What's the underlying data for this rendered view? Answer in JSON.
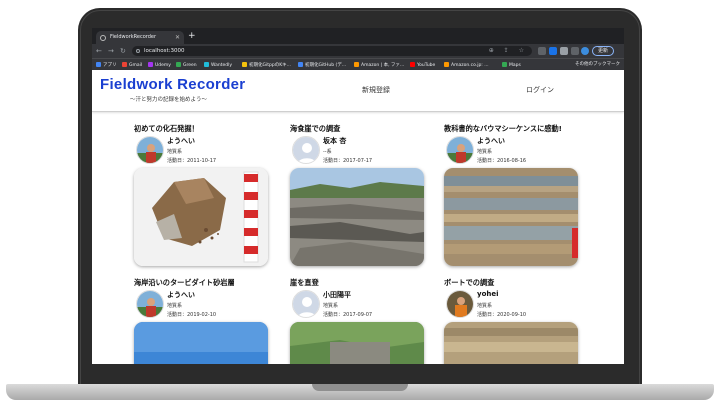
{
  "browser": {
    "tab_title": "FieldworkRecorder",
    "new_tab": "+",
    "url": "localhost:3000",
    "update_label": "更新",
    "bookmarks": [
      {
        "label": "アプリ",
        "icon": "apps-icon",
        "color": "#4285f4"
      },
      {
        "label": "Gmail",
        "icon": "gmail-icon",
        "color": "#ea4335"
      },
      {
        "label": "Udemy",
        "icon": "udemy-icon",
        "color": "#a435f0"
      },
      {
        "label": "Green",
        "icon": "green-icon",
        "color": "#34a853"
      },
      {
        "label": "Wantedly",
        "icon": "wantedly-icon",
        "color": "#21bddb"
      },
      {
        "label": "初期化GitppのKキ...",
        "icon": "bookmark-icon",
        "color": "#f4c20d"
      },
      {
        "label": "初期化GitHub (デ...",
        "icon": "bookmark-icon",
        "color": "#4285f4"
      },
      {
        "label": "Amazon | 本, ファ...",
        "icon": "amazon-icon",
        "color": "#ff9900"
      },
      {
        "label": "YouTube",
        "icon": "youtube-icon",
        "color": "#ff0000"
      },
      {
        "label": "Amazon.co.jp: ...",
        "icon": "amazon-icon",
        "color": "#ff9900"
      },
      {
        "label": "Maps",
        "icon": "maps-icon",
        "color": "#34a853"
      }
    ],
    "other_bookmarks": "その他のブックマーク"
  },
  "header": {
    "logo": "Fieldwork Recorder",
    "tagline": "〜汗と努力の記録を始めよう〜",
    "nav_signup": "新規登録",
    "nav_login": "ログイン"
  },
  "posts": [
    {
      "title": "初めての化石発掘！",
      "user": "ようへい",
      "field": "地質系",
      "date": "活動日：2011-10-17",
      "avatar": "photo",
      "photo": "fossil"
    },
    {
      "title": "海食崖での調査",
      "user": "坂本 杏",
      "field": "--系",
      "date": "活動日：2017-07-17",
      "avatar": "default",
      "photo": "coast"
    },
    {
      "title": "教科書的なバウマシーケンスに感動!",
      "user": "ようへい",
      "field": "地質系",
      "date": "活動日：2016-08-16",
      "avatar": "photo",
      "photo": "strata"
    },
    {
      "title": "海岸沿いのタービダイト砂岩層",
      "user": "ようへい",
      "field": "地質系",
      "date": "活動日：2019-02-10",
      "avatar": "photo",
      "photo": "sky"
    },
    {
      "title": "崖を直登",
      "user": "小田陽平",
      "field": "地質系",
      "date": "活動日：2017-09-07",
      "avatar": "default",
      "photo": "cliff"
    },
    {
      "title": "ボートでの調査",
      "user": "yohei",
      "field": "地質系",
      "date": "活動日：2020-09-10",
      "avatar": "boat",
      "photo": "sand"
    }
  ],
  "colors": {
    "logo": "#1a3fd1",
    "laptop": "#2b2b2b"
  }
}
